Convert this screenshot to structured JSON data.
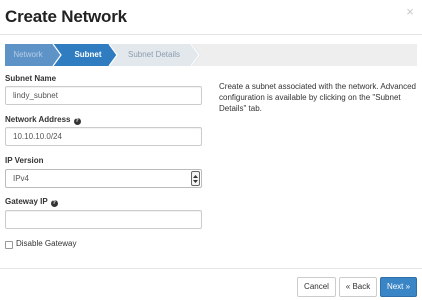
{
  "modal": {
    "title": "Create Network",
    "close_glyph": "×"
  },
  "wizard": {
    "steps": [
      {
        "label": "Network",
        "state": "completed"
      },
      {
        "label": "Subnet",
        "state": "active"
      },
      {
        "label": "Subnet Details",
        "state": "upcoming"
      }
    ]
  },
  "form": {
    "subnet_name": {
      "label": "Subnet Name",
      "value": "lindy_subnet"
    },
    "network_address": {
      "label": "Network Address",
      "value": "10.10.10.0/24",
      "help_icon": "question-circle-icon"
    },
    "ip_version": {
      "label": "IP Version",
      "selected": "IPv4"
    },
    "gateway_ip": {
      "label": "Gateway IP",
      "value": "",
      "help_icon": "question-circle-icon"
    },
    "disable_gateway": {
      "label": "Disable Gateway",
      "checked": false
    }
  },
  "help_text": "Create a subnet associated with the network. Advanced configuration is available by clicking on the \"Subnet Details\" tab.",
  "footer": {
    "cancel_label": "Cancel",
    "back_label": "« Back",
    "next_label": "Next »"
  },
  "colors": {
    "completed_step": "#5e93c8",
    "active_step": "#2f7cc1",
    "upcoming_step": "#e3e8ed",
    "primary_button": "#3a85c6"
  }
}
